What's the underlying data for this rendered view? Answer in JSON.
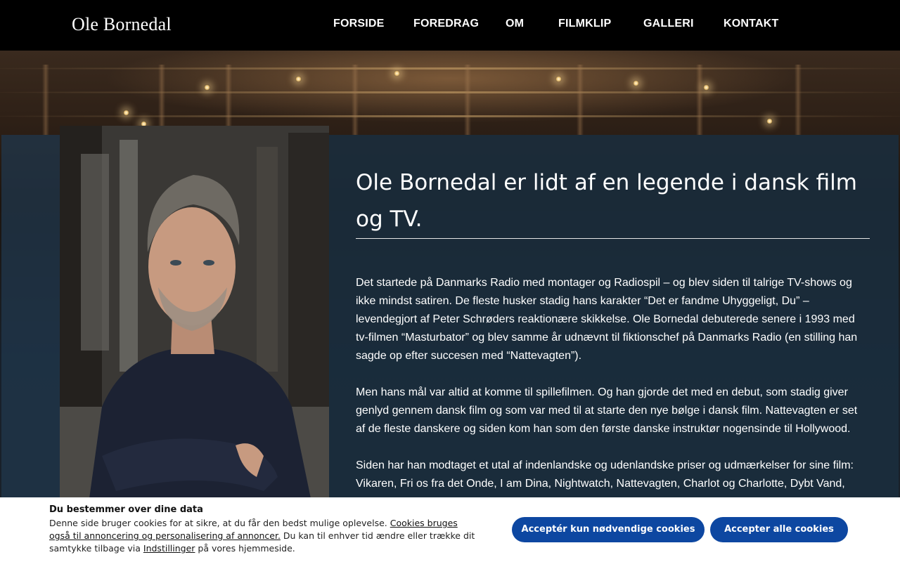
{
  "header": {
    "logo": "Ole Bornedal",
    "nav": [
      "FORSIDE",
      "FOREDRAG",
      "OM",
      "FILMKLIP",
      "GALLERI",
      "KONTAKT"
    ]
  },
  "content": {
    "heading": "Ole Bornedal er lidt af en legende i dansk film og TV.",
    "paragraphs": [
      "Det startede på Danmarks Radio med montager og Radiospil – og blev siden til talrige TV-shows og ikke mindst satiren. De fleste husker stadig hans karakter “Det er fandme Uhyggeligt, Du” – levendegjort af Peter Schrøders reaktionære skikkelse. Ole Bornedal debuterede senere i 1993 med tv-filmen “Masturbator” og blev samme år udnævnt til fiktionschef på Danmarks Radio (en stilling han sagde op efter succesen med “Nattevagten”).",
      "Men hans mål var altid at komme til spillefilmen. Og han gjorde det med en debut, som stadig giver genlyd gennem dansk film og som var med til at starte den nye bølge i dansk film. Nattevagten er set af de fleste danskere og siden kom han som den første danske instruktør nogensinde til Hollywood.",
      "Siden har han modtaget et utal af indenlandske og udenlandske priser og udmærkelser for sine film: Vikaren, Fri os fra det Onde, I am Dina, Nightwatch, Nattevagten, Charlot og Charlotte, Dybt Vand,"
    ]
  },
  "cookie": {
    "title": "Du bestemmer over dine data",
    "text_1": "Denne side bruger cookies for at sikre, at du får den bedst mulige oplevelse. ",
    "link_1": "Cookies bruges også til annoncering og personalisering af annoncer.",
    "text_2": " Du kan til enhver tid ændre eller trække dit samtykke tilbage via ",
    "link_2": "Indstillinger",
    "text_3": " på vores hjemmeside.",
    "btn_necessary": "Acceptér kun nødvendige cookies",
    "btn_all": "Accepter alle cookies"
  },
  "colors": {
    "header_bg": "#000000",
    "panel_bg": "#1a2d3e",
    "button": "#0d47a1"
  }
}
